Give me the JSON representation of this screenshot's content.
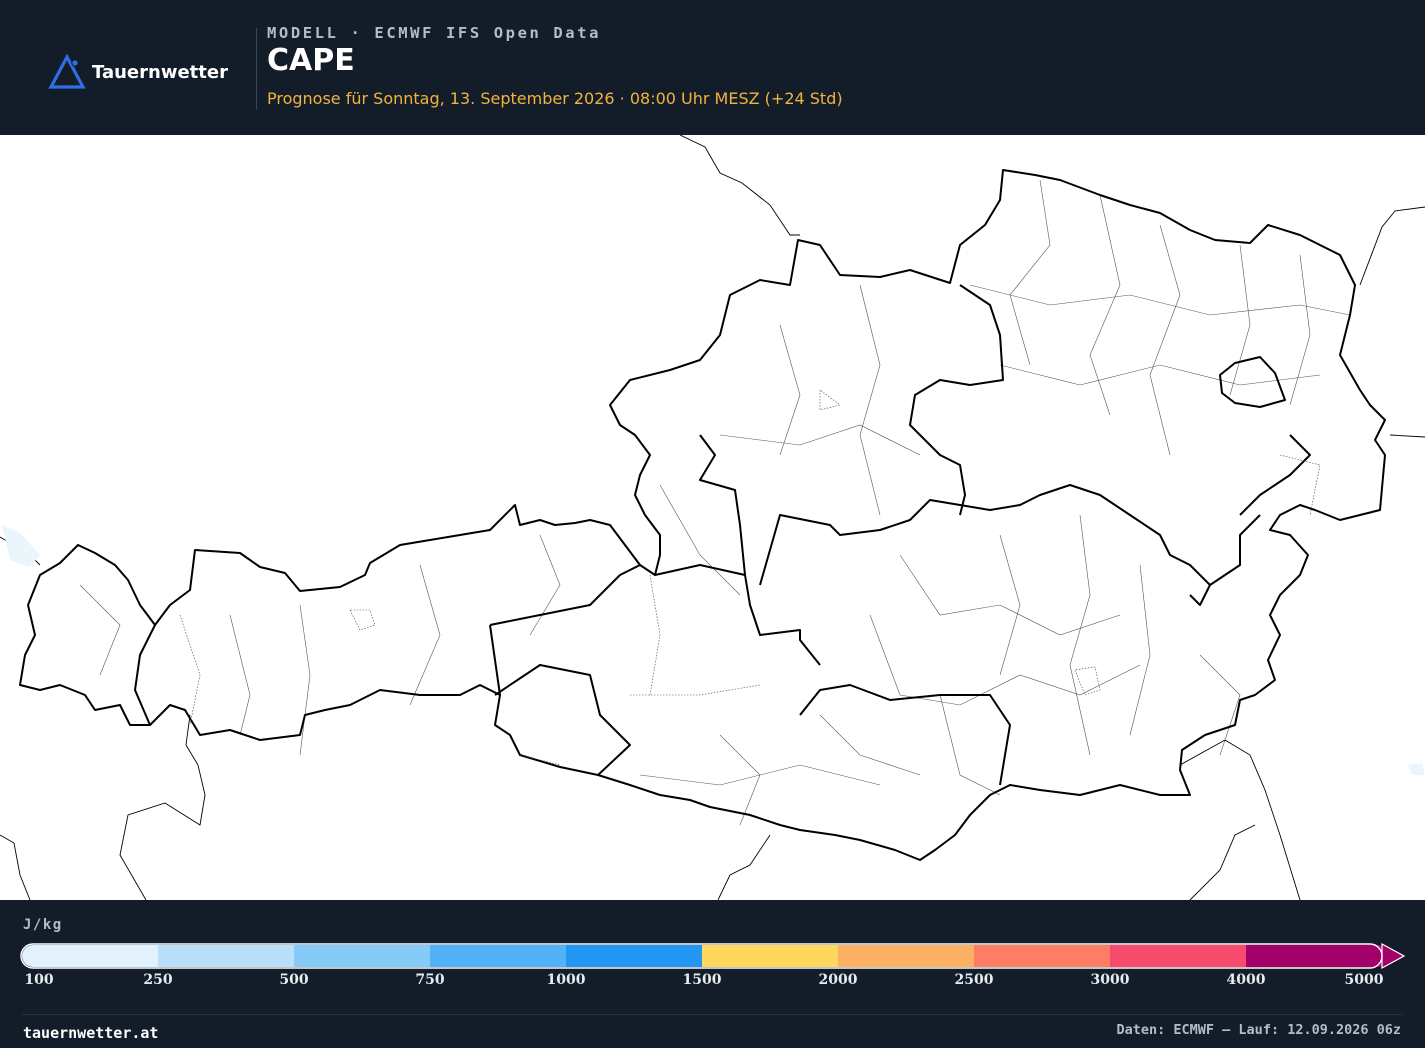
{
  "brand": {
    "name": "Tauernwetter",
    "icon": "triangle-logo-icon"
  },
  "header": {
    "model_line": "MODELL · ECMWF IFS Open Data",
    "title": "CAPE",
    "subtitle": "Prognose für Sonntag, 13. September 2026 · 08:00 Uhr MESZ  (+24 Std)"
  },
  "map": {
    "region": "Austria",
    "background_color": "#ffffff",
    "outline_color": "#000000"
  },
  "legend": {
    "unit": "J/kg",
    "bins": [
      {
        "from": 100,
        "to": 250,
        "color": "#e1f2fd"
      },
      {
        "from": 250,
        "to": 500,
        "color": "#b9e0fb"
      },
      {
        "from": 500,
        "to": 750,
        "color": "#86cbf7"
      },
      {
        "from": 750,
        "to": 1000,
        "color": "#52b2f5"
      },
      {
        "from": 1000,
        "to": 1500,
        "color": "#2196f3"
      },
      {
        "from": 1500,
        "to": 2000,
        "color": "#fdd85d"
      },
      {
        "from": 2000,
        "to": 2500,
        "color": "#fdaf62"
      },
      {
        "from": 2500,
        "to": 3000,
        "color": "#fe7e65"
      },
      {
        "from": 3000,
        "to": 4000,
        "color": "#f84a6d"
      },
      {
        "from": 4000,
        "to": 5000,
        "color": "#a3006a"
      }
    ],
    "ticks": [
      "100",
      "250",
      "500",
      "750",
      "1000",
      "1500",
      "2000",
      "2500",
      "3000",
      "4000",
      "5000"
    ],
    "overflow_arrow": true
  },
  "footer": {
    "site": "tauernwetter.at",
    "source": "Daten: ECMWF – Lauf: 12.09.2026 06z"
  }
}
